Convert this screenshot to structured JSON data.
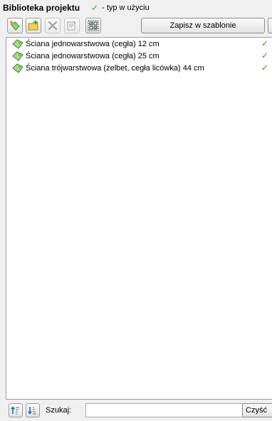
{
  "header": {
    "title": "Biblioteka projektu",
    "legend_check": "✓",
    "legend_text": "- typ w użyciu"
  },
  "toolbar": {
    "buttons": [
      {
        "icon": "add-wall-type-icon",
        "enabled": true
      },
      {
        "icon": "add-folder-icon",
        "enabled": true
      },
      {
        "icon": "delete-icon",
        "enabled": false
      },
      {
        "icon": "properties-icon",
        "enabled": false
      },
      {
        "icon": "select-all-icon",
        "enabled": true
      }
    ],
    "save_label": "Zapisz w szablonie",
    "dropdown_icon": "chevron-down-icon"
  },
  "items": [
    {
      "label": "Ściana jednowarstwowa (cegła) 12 cm",
      "used": "✓"
    },
    {
      "label": "Ściana jednowarstwowa (cegła) 25 cm",
      "used": "✓"
    },
    {
      "label": "Ściana trójwarstwowa (żelbet, cegła licówka) 44 cm",
      "used": "✓"
    }
  ],
  "search": {
    "label": "Szukaj:",
    "value": "",
    "clear_label": "Czyść"
  },
  "colors": {
    "check": "#2e9a2e",
    "icon_green": "#4a9a3a",
    "add_star": "#e08a10",
    "delete_x": "#a8a8a8",
    "sort_blue": "#2f6fd0"
  }
}
